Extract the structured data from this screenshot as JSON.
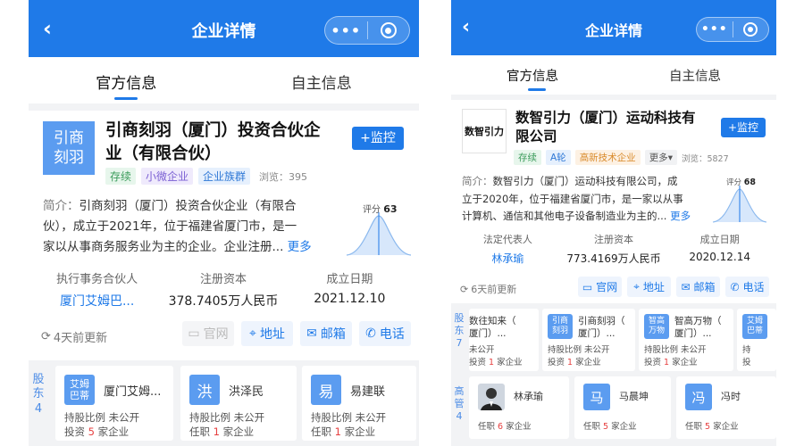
{
  "colors": {
    "primary": "#1f7ae8",
    "background_gray": "#f2f3f5"
  },
  "left": {
    "topbar": {
      "title": "企业详情",
      "back_icon": "chevron-left-icon",
      "menu_icon": "more-dots-icon",
      "close_icon": "target-circle-icon"
    },
    "tabs": [
      {
        "label": "官方信息",
        "active": true
      },
      {
        "label": "自主信息",
        "active": false
      }
    ],
    "company": {
      "logo_text": "引商刻羽",
      "name_line1": "引商刻羽（厦门）投资合伙企",
      "name_line2": "业（有限合伙）",
      "monitor_label": "+监控",
      "tags": [
        "存续",
        "小微企业",
        "企业族群"
      ],
      "views": "浏览：395",
      "intro_label": "简介：",
      "intro_line1": "引商刻羽（厦门）投资合伙企业（有限合",
      "intro_line2": "伙），成立于2021年，位于福建省厦门市，是一",
      "intro_line3": "家以从事商务服务业为主的企业。企业注册...",
      "more_label": "更多",
      "score_label": "评分",
      "score_value": "63"
    },
    "facts": [
      {
        "label": "执行事务合伙人",
        "value": "厦门艾姆巴..."
      },
      {
        "label": "注册资本",
        "value": "378.7405万人民币"
      },
      {
        "label": "成立日期",
        "value": "2021.12.10"
      }
    ],
    "update_text": "4天前更新",
    "actions": [
      "官网",
      "地址",
      "邮箱",
      "电话"
    ],
    "shareholders": {
      "side_label": "股东",
      "count": "4",
      "cards": [
        {
          "logo": "艾姆巴蒂",
          "name": "厦门艾姆...",
          "line1": "持股比例 未公开",
          "line2_pre": "投资 ",
          "line2_num": "5",
          "line2_post": " 家企业"
        },
        {
          "logo": "洪",
          "name": "洪泽民",
          "line1": "持股比例 未公开",
          "line2_pre": "任职 ",
          "line2_num": "1",
          "line2_post": " 家企业"
        },
        {
          "logo": "易",
          "name": "易建联",
          "line1": "持股比例 未公开",
          "line2_pre": "任职 ",
          "line2_num": "1",
          "line2_post": " 家企业"
        }
      ]
    }
  },
  "right": {
    "topbar": {
      "title": "企业详情",
      "back_icon": "chevron-left-icon",
      "menu_icon": "more-dots-icon",
      "close_icon": "target-circle-icon"
    },
    "tabs": [
      {
        "label": "官方信息",
        "active": true
      },
      {
        "label": "自主信息",
        "active": false
      }
    ],
    "company": {
      "logo_text": "数智引力",
      "name_line1": "数智引力（厦门）运动科技有",
      "name_line2": "限公司",
      "monitor_label": "+监控",
      "tags": [
        "存续",
        "A轮",
        "高新技术企业",
        "更多"
      ],
      "views": "浏览：5827",
      "intro_label": "简介：",
      "intro_line1": "数智引力（厦门）运动科技有限公司，成",
      "intro_line2": "立于2020年，位于福建省厦门市，是一家以从事",
      "intro_line3": "计算机、通信和其他电子设备制造业为主的...",
      "more_label": "更多",
      "score_label": "评分",
      "score_value": "68"
    },
    "facts": [
      {
        "label": "法定代表人",
        "value": "林承瑜"
      },
      {
        "label": "注册资本",
        "value": "773.4169万人民币"
      },
      {
        "label": "成立日期",
        "value": "2020.12.14"
      }
    ],
    "update_text": "6天前更新",
    "actions": [
      "官网",
      "地址",
      "邮箱",
      "电话"
    ],
    "shareholders": {
      "side_label": "股东",
      "count": "7",
      "cards": [
        {
          "logo": "",
          "name": "数往知来（",
          "sub": "厦门）...",
          "line1": "未公开",
          "line2_pre": "投资 ",
          "line2_num": "1",
          "line2_post": " 家企业"
        },
        {
          "logo": "引商刻羽",
          "name": "引商刻羽（",
          "sub": "厦门）...",
          "line1": "持股比例 未公开",
          "line2_pre": "投资 ",
          "line2_num": "1",
          "line2_post": " 家企业"
        },
        {
          "logo": "智高万物",
          "name": "智高万物（",
          "sub": "厦门）...",
          "line1": "持股比例 未公开",
          "line2_pre": "投资 ",
          "line2_num": "1",
          "line2_post": " 家企业"
        },
        {
          "logo": "艾姆巴蒂",
          "name": "",
          "sub": "",
          "line1": "持",
          "line2_pre": "投",
          "line2_num": "",
          "line2_post": ""
        }
      ]
    },
    "executives": {
      "side_label": "高管",
      "count": "4",
      "cards": [
        {
          "logo": "",
          "name": "林承瑜",
          "line2_pre": "任职 ",
          "line2_num": "6",
          "line2_post": " 家企业"
        },
        {
          "logo": "马",
          "name": "马晨坤",
          "line2_pre": "任职 ",
          "line2_num": "5",
          "line2_post": " 家企业"
        },
        {
          "logo": "冯",
          "name": "冯时",
          "line2_pre": "任职 ",
          "line2_num": "5",
          "line2_post": " 家企业"
        }
      ]
    }
  }
}
